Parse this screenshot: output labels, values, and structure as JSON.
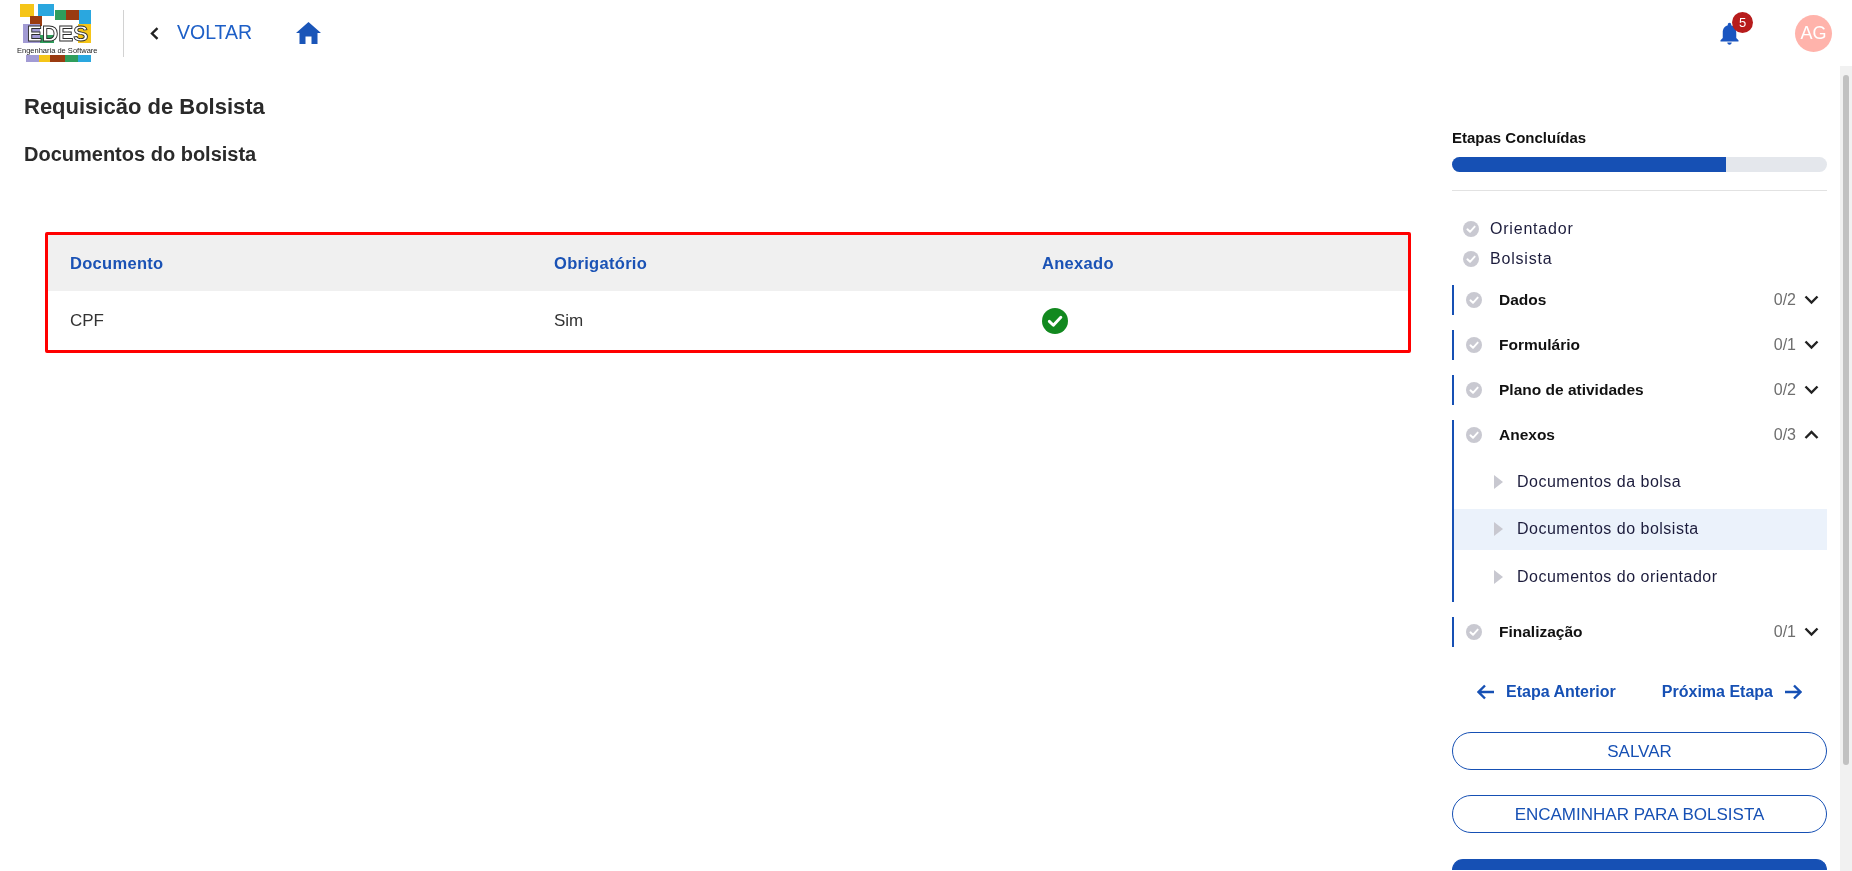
{
  "header": {
    "logo": {
      "title": "EDES",
      "subtitle": "Engenharia de Software"
    },
    "back_label": "VOLTAR",
    "notifications": {
      "count": "5"
    },
    "avatar": {
      "initials": "AG"
    }
  },
  "page": {
    "title": "Requisicão de Bolsista",
    "section_title": "Documentos do bolsista"
  },
  "table": {
    "highlighted": true,
    "columns": [
      "Documento",
      "Obrigatório",
      "Anexado"
    ],
    "rows": [
      {
        "document": "CPF",
        "required": "Sim",
        "attached": true
      }
    ]
  },
  "sidebar": {
    "progress": {
      "title": "Etapas Concluídas",
      "level": 0.73
    },
    "steps": [
      {
        "label": "Orientador",
        "completed": false
      },
      {
        "label": "Bolsista",
        "completed": false
      }
    ],
    "sections": [
      {
        "label": "Dados",
        "count": "0/2",
        "completed": false,
        "expanded": false
      },
      {
        "label": "Formulário",
        "count": "0/1",
        "completed": false,
        "expanded": false
      },
      {
        "label": "Plano de atividades",
        "count": "0/2",
        "completed": false,
        "expanded": false
      },
      {
        "label": "Anexos",
        "count": "0/3",
        "completed": false,
        "expanded": true,
        "children": [
          {
            "label": "Documentos da bolsa",
            "selected": false
          },
          {
            "label": "Documentos do bolsista",
            "selected": true
          },
          {
            "label": "Documentos do orientador",
            "selected": false
          }
        ]
      },
      {
        "label": "Finalização",
        "count": "0/1",
        "completed": false,
        "expanded": false
      }
    ],
    "navigation": {
      "previous": "Etapa Anterior",
      "next": "Próxima Etapa"
    },
    "buttons": [
      {
        "kind": "outline",
        "label": "SALVAR"
      },
      {
        "kind": "outline",
        "label": "ENCAMINHAR PARA BOLSISTA"
      },
      {
        "kind": "filled"
      }
    ]
  }
}
